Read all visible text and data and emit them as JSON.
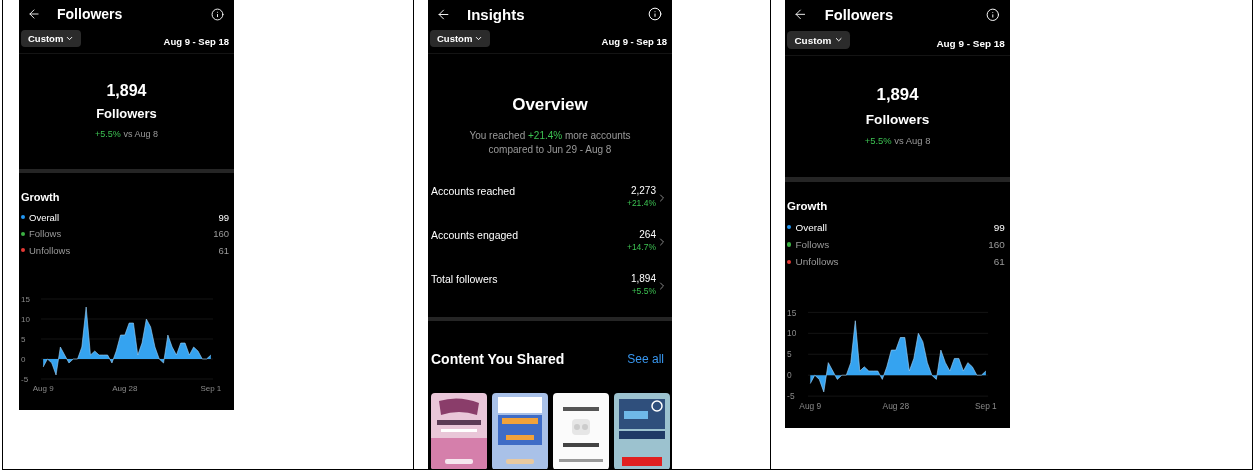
{
  "cells": [
    {
      "kind": "followers",
      "header": {
        "title": "Followers"
      },
      "filter": {
        "label": "Custom"
      },
      "date_range": "Aug 9 - Sep 18",
      "summary": {
        "count": "1,894",
        "label": "Followers",
        "change": "+5.5%",
        "comparison": "vs Aug 8"
      },
      "growth": {
        "title": "Growth",
        "legend": [
          {
            "label": "Overall",
            "value": "99",
            "color": "#2196f3"
          },
          {
            "label": "Follows",
            "value": "160",
            "color": "#3cb043"
          },
          {
            "label": "Unfollows",
            "value": "61",
            "color": "#e53935"
          }
        ]
      },
      "chart_data": {
        "type": "area",
        "grid": true,
        "categories": [
          "Aug 9",
          null,
          null,
          null,
          null,
          null,
          null,
          null,
          null,
          null,
          null,
          null,
          null,
          null,
          null,
          null,
          null,
          null,
          null,
          "Aug 28",
          null,
          null,
          null,
          null,
          null,
          null,
          null,
          null,
          null,
          null,
          null,
          null,
          null,
          null,
          null,
          null,
          null,
          null,
          null,
          "Sep 1"
        ],
        "ylim": [
          -5,
          15
        ],
        "yticks": [
          -5,
          0,
          5,
          10,
          15
        ],
        "series": [
          {
            "color": "#35a3f0",
            "values": [
              -2,
              0,
              -1,
              -4,
              3,
              1,
              -1,
              0,
              0,
              3,
              13,
              1,
              2,
              1,
              1,
              1,
              -1,
              2,
              6,
              6,
              9,
              9,
              1,
              4,
              10,
              8,
              3,
              0,
              -1,
              6,
              3,
              1,
              4,
              4,
              1,
              3,
              2,
              0,
              0,
              1
            ]
          }
        ]
      }
    },
    {
      "kind": "insights",
      "header": {
        "title": "Insights"
      },
      "filter": {
        "label": "Custom"
      },
      "date_range": "Aug 9 - Sep 18",
      "overview": {
        "title": "Overview",
        "text_before": "You reached ",
        "highlight": "+21.4%",
        "text_after": " more accounts compared to Jun 29 - Aug 8"
      },
      "metrics": [
        {
          "label": "Accounts reached",
          "value": "2,273",
          "change": "+21.4%"
        },
        {
          "label": "Accounts engaged",
          "value": "264",
          "change": "+14.7%"
        },
        {
          "label": "Total followers",
          "value": "1,894",
          "change": "+5.5%"
        }
      ],
      "content": {
        "title": "Content You Shared",
        "link": "See all"
      }
    },
    {
      "kind": "followers",
      "header": {
        "title": "Followers"
      },
      "filter": {
        "label": "Custom"
      },
      "date_range": "Aug 9 - Sep 18",
      "summary": {
        "count": "1,894",
        "label": "Followers",
        "change": "+5.5%",
        "comparison": "vs Aug 8"
      },
      "growth": {
        "title": "Growth",
        "legend": [
          {
            "label": "Overall",
            "value": "99",
            "color": "#2196f3"
          },
          {
            "label": "Follows",
            "value": "160",
            "color": "#3cb043"
          },
          {
            "label": "Unfollows",
            "value": "61",
            "color": "#e53935"
          }
        ]
      },
      "chart_data": {
        "type": "area",
        "grid": true,
        "categories": [
          "Aug 9",
          null,
          null,
          null,
          null,
          null,
          null,
          null,
          null,
          null,
          null,
          null,
          null,
          null,
          null,
          null,
          null,
          null,
          null,
          "Aug 28",
          null,
          null,
          null,
          null,
          null,
          null,
          null,
          null,
          null,
          null,
          null,
          null,
          null,
          null,
          null,
          null,
          null,
          null,
          null,
          "Sep 1"
        ],
        "ylim": [
          -5,
          15
        ],
        "yticks": [
          -5,
          0,
          5,
          10,
          15
        ],
        "series": [
          {
            "color": "#35a3f0",
            "values": [
              -2,
              0,
              -1,
              -4,
              3,
              1,
              -1,
              0,
              0,
              3,
              13,
              1,
              2,
              1,
              1,
              1,
              -1,
              2,
              6,
              6,
              9,
              9,
              1,
              4,
              10,
              8,
              3,
              0,
              -1,
              6,
              3,
              1,
              4,
              4,
              1,
              3,
              2,
              0,
              0,
              1
            ]
          }
        ]
      }
    }
  ]
}
